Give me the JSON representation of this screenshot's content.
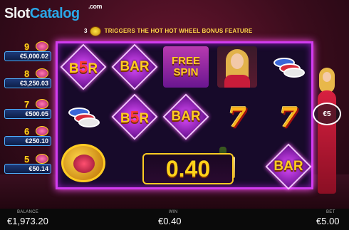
{
  "logo": {
    "part_a": "Slot",
    "part_b": "Catalog",
    "com": ".com"
  },
  "bonus": {
    "count": "3",
    "text": "TRIGGERS THE HOT HOT WHEEL BONUS FEATURE"
  },
  "paytable": [
    {
      "count": "9",
      "value": "€5,000.02"
    },
    {
      "count": "8",
      "value": "€3,250.03"
    },
    {
      "count": "7",
      "value": "€500.05"
    },
    {
      "count": "6",
      "value": "€250.10"
    },
    {
      "count": "5",
      "value": "€50.14"
    }
  ],
  "reels": [
    [
      "b5r",
      "chips",
      "orb"
    ],
    [
      "bar",
      "b5r",
      "bar-partial"
    ],
    [
      "free-spin",
      "bar",
      "win-amount"
    ],
    [
      "woman",
      "seven",
      "champagne"
    ],
    [
      "chips",
      "seven",
      "bar"
    ]
  ],
  "symbols": {
    "bar": "BAR",
    "b5r_left": "B",
    "b5r_five": "5",
    "b5r_right": "R",
    "free_spin_1": "FREE",
    "free_spin_2": "SPIN",
    "seven": "7"
  },
  "win_display": "0.40",
  "bet_button": "€5",
  "footer": {
    "balance_label": "BALANCE",
    "balance_value": "€1,973.20",
    "win_label": "WIN",
    "win_value": "€0.40",
    "bet_label": "BET",
    "bet_value": "€5.00"
  },
  "colors": {
    "reel_border": "#d23cf0",
    "gold": "#ffd21a",
    "accent_blue": "#2aa8e8"
  }
}
